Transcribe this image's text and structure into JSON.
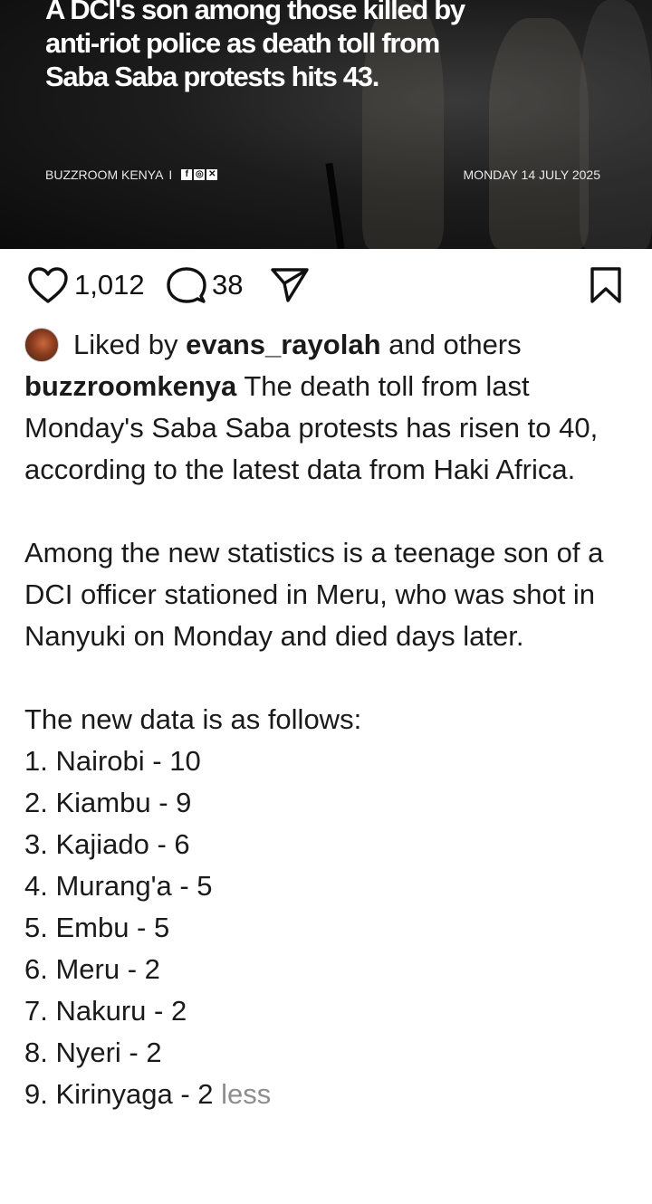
{
  "post_image": {
    "headline": "A DCI's son among those killed by anti-riot police as death toll from Saba Saba protests hits 43.",
    "source": "BUZZROOM KENYA",
    "separator": "I",
    "date": "MONDAY 14 JULY 2025",
    "social_icons": [
      "facebook-icon",
      "instagram-icon",
      "x-icon"
    ]
  },
  "actions": {
    "likes": "1,012",
    "comments": "38"
  },
  "liked_by": {
    "prefix": "Liked by",
    "user": "evans_rayolah",
    "suffix": "and others"
  },
  "caption": {
    "username": "buzzroomkenya",
    "intro": "The death toll from last Monday's Saba Saba protests has risen to 40, according to the latest data from Haki Africa.",
    "paragraph2": "Among the new statistics is a teenage son of a DCI officer stationed in Meru, who was shot in Nanyuki on Monday and died days later.",
    "list_heading": "The new data is as follows:",
    "list": [
      "1. Nairobi - 10",
      "2. Kiambu - 9",
      "3. Kajiado - 6",
      "4. Murang'a - 5",
      "5. Embu - 5",
      "6. Meru - 2",
      "7. Nakuru - 2",
      "8. Nyeri - 2",
      "9. Kirinyaga - 2"
    ],
    "less_link": "less"
  }
}
